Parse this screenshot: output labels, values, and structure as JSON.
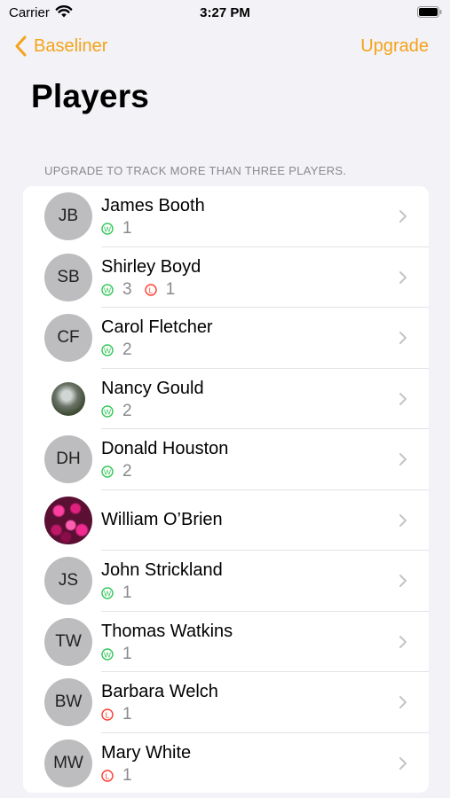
{
  "status_bar": {
    "carrier": "Carrier",
    "time": "3:27 PM"
  },
  "nav": {
    "back_label": "Baseliner",
    "upgrade_label": "Upgrade"
  },
  "page": {
    "title": "Players",
    "section_header": "UPGRADE TO TRACK MORE THAN THREE PLAYERS."
  },
  "colors": {
    "accent": "#f5a319",
    "win": "#34c759",
    "loss": "#ff3b30",
    "background": "#f2f2f7"
  },
  "players": [
    {
      "name": "James Booth",
      "initials": "JB",
      "avatar": "initials",
      "wins": "1",
      "losses": null
    },
    {
      "name": "Shirley Boyd",
      "initials": "SB",
      "avatar": "initials",
      "wins": "3",
      "losses": "1"
    },
    {
      "name": "Carol Fletcher",
      "initials": "CF",
      "avatar": "initials",
      "wins": "2",
      "losses": null
    },
    {
      "name": "Nancy Gould",
      "initials": "",
      "avatar": "photo-waterfall",
      "wins": "2",
      "losses": null
    },
    {
      "name": "Donald Houston",
      "initials": "DH",
      "avatar": "initials",
      "wins": "2",
      "losses": null
    },
    {
      "name": "William O’Brien",
      "initials": "",
      "avatar": "photo-flowers",
      "wins": null,
      "losses": null
    },
    {
      "name": "John Strickland",
      "initials": "JS",
      "avatar": "initials",
      "wins": "1",
      "losses": null
    },
    {
      "name": "Thomas Watkins",
      "initials": "TW",
      "avatar": "initials",
      "wins": "1",
      "losses": null
    },
    {
      "name": "Barbara Welch",
      "initials": "BW",
      "avatar": "initials",
      "wins": null,
      "losses": "1"
    },
    {
      "name": "Mary White",
      "initials": "MW",
      "avatar": "initials",
      "wins": null,
      "losses": "1"
    }
  ]
}
